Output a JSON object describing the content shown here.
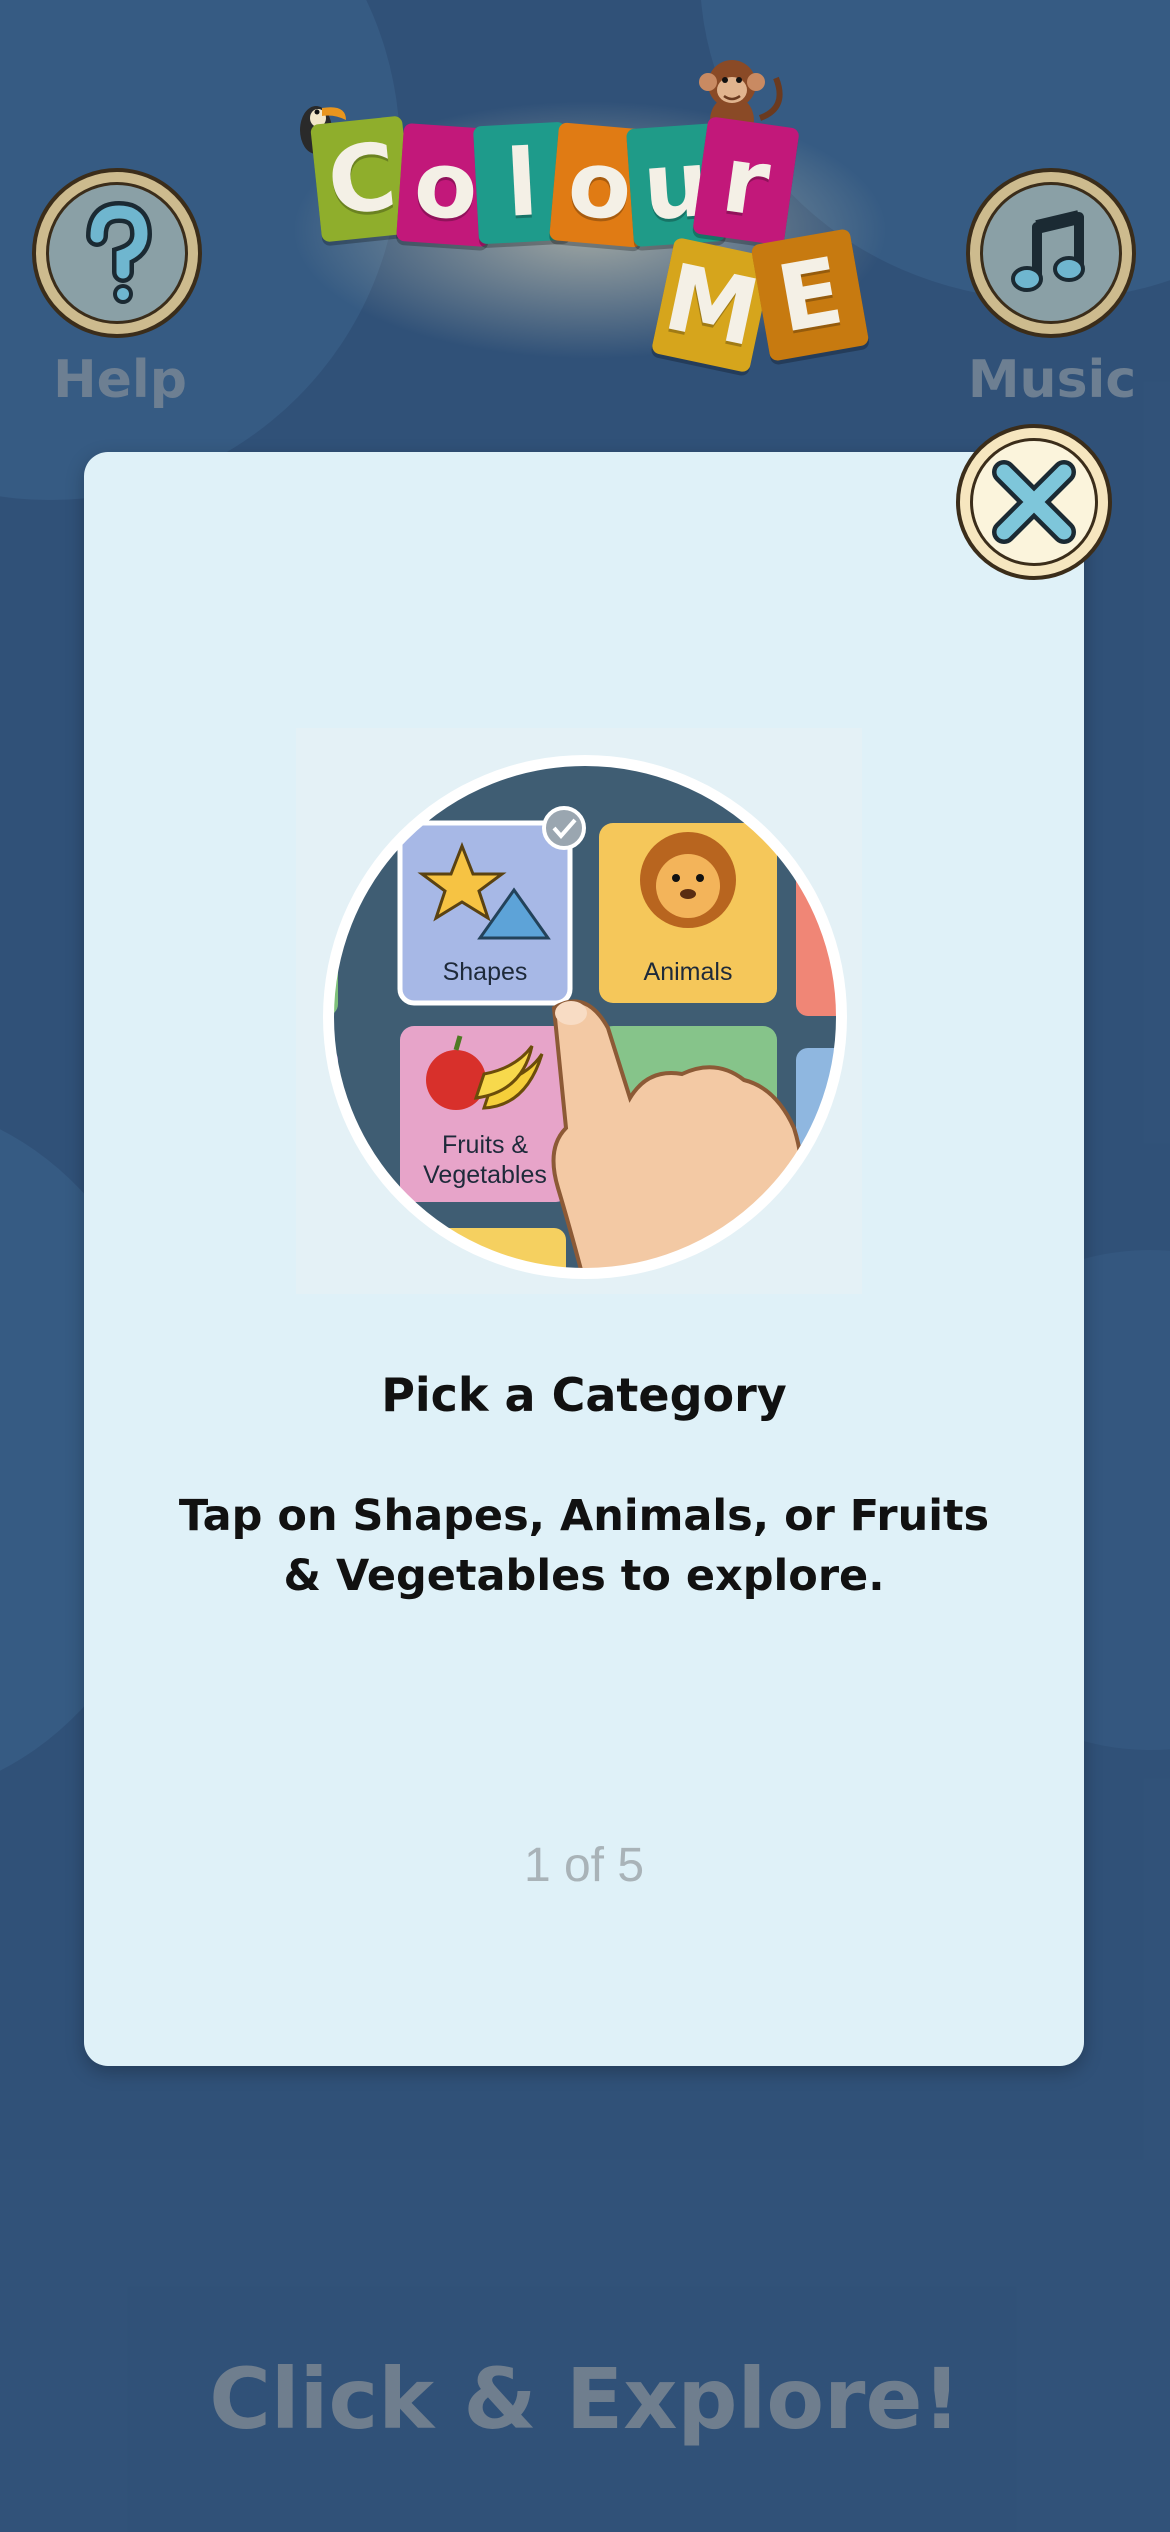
{
  "logo": {
    "letters": [
      "C",
      "o",
      "l",
      "o",
      "u",
      "r"
    ],
    "letters2": [
      "M",
      "E"
    ],
    "colors": [
      "#8fae2c",
      "#c2187a",
      "#1e9b8b",
      "#e07b14",
      "#1f9b88",
      "#c2187a",
      "#d6a51c",
      "#c77a10"
    ]
  },
  "help_button": {
    "label": "Help",
    "icon": "question-mark-icon"
  },
  "music_button": {
    "label": "Music",
    "icon": "music-note-icon"
  },
  "modal": {
    "close_icon": "close-icon",
    "illustration": {
      "tiles": [
        "Shapes",
        "Animals",
        "Fruits &",
        "Vegetables"
      ]
    },
    "title": "Pick a Category",
    "description": "Tap on Shapes, Animals, or Fruits & Vegetables to explore.",
    "pager": "1 of 5"
  },
  "footer": {
    "text": "Click & Explore!"
  },
  "colors": {
    "background": "#3a5f88",
    "card": "#dff1f8",
    "accent": "#4fa3c7"
  }
}
